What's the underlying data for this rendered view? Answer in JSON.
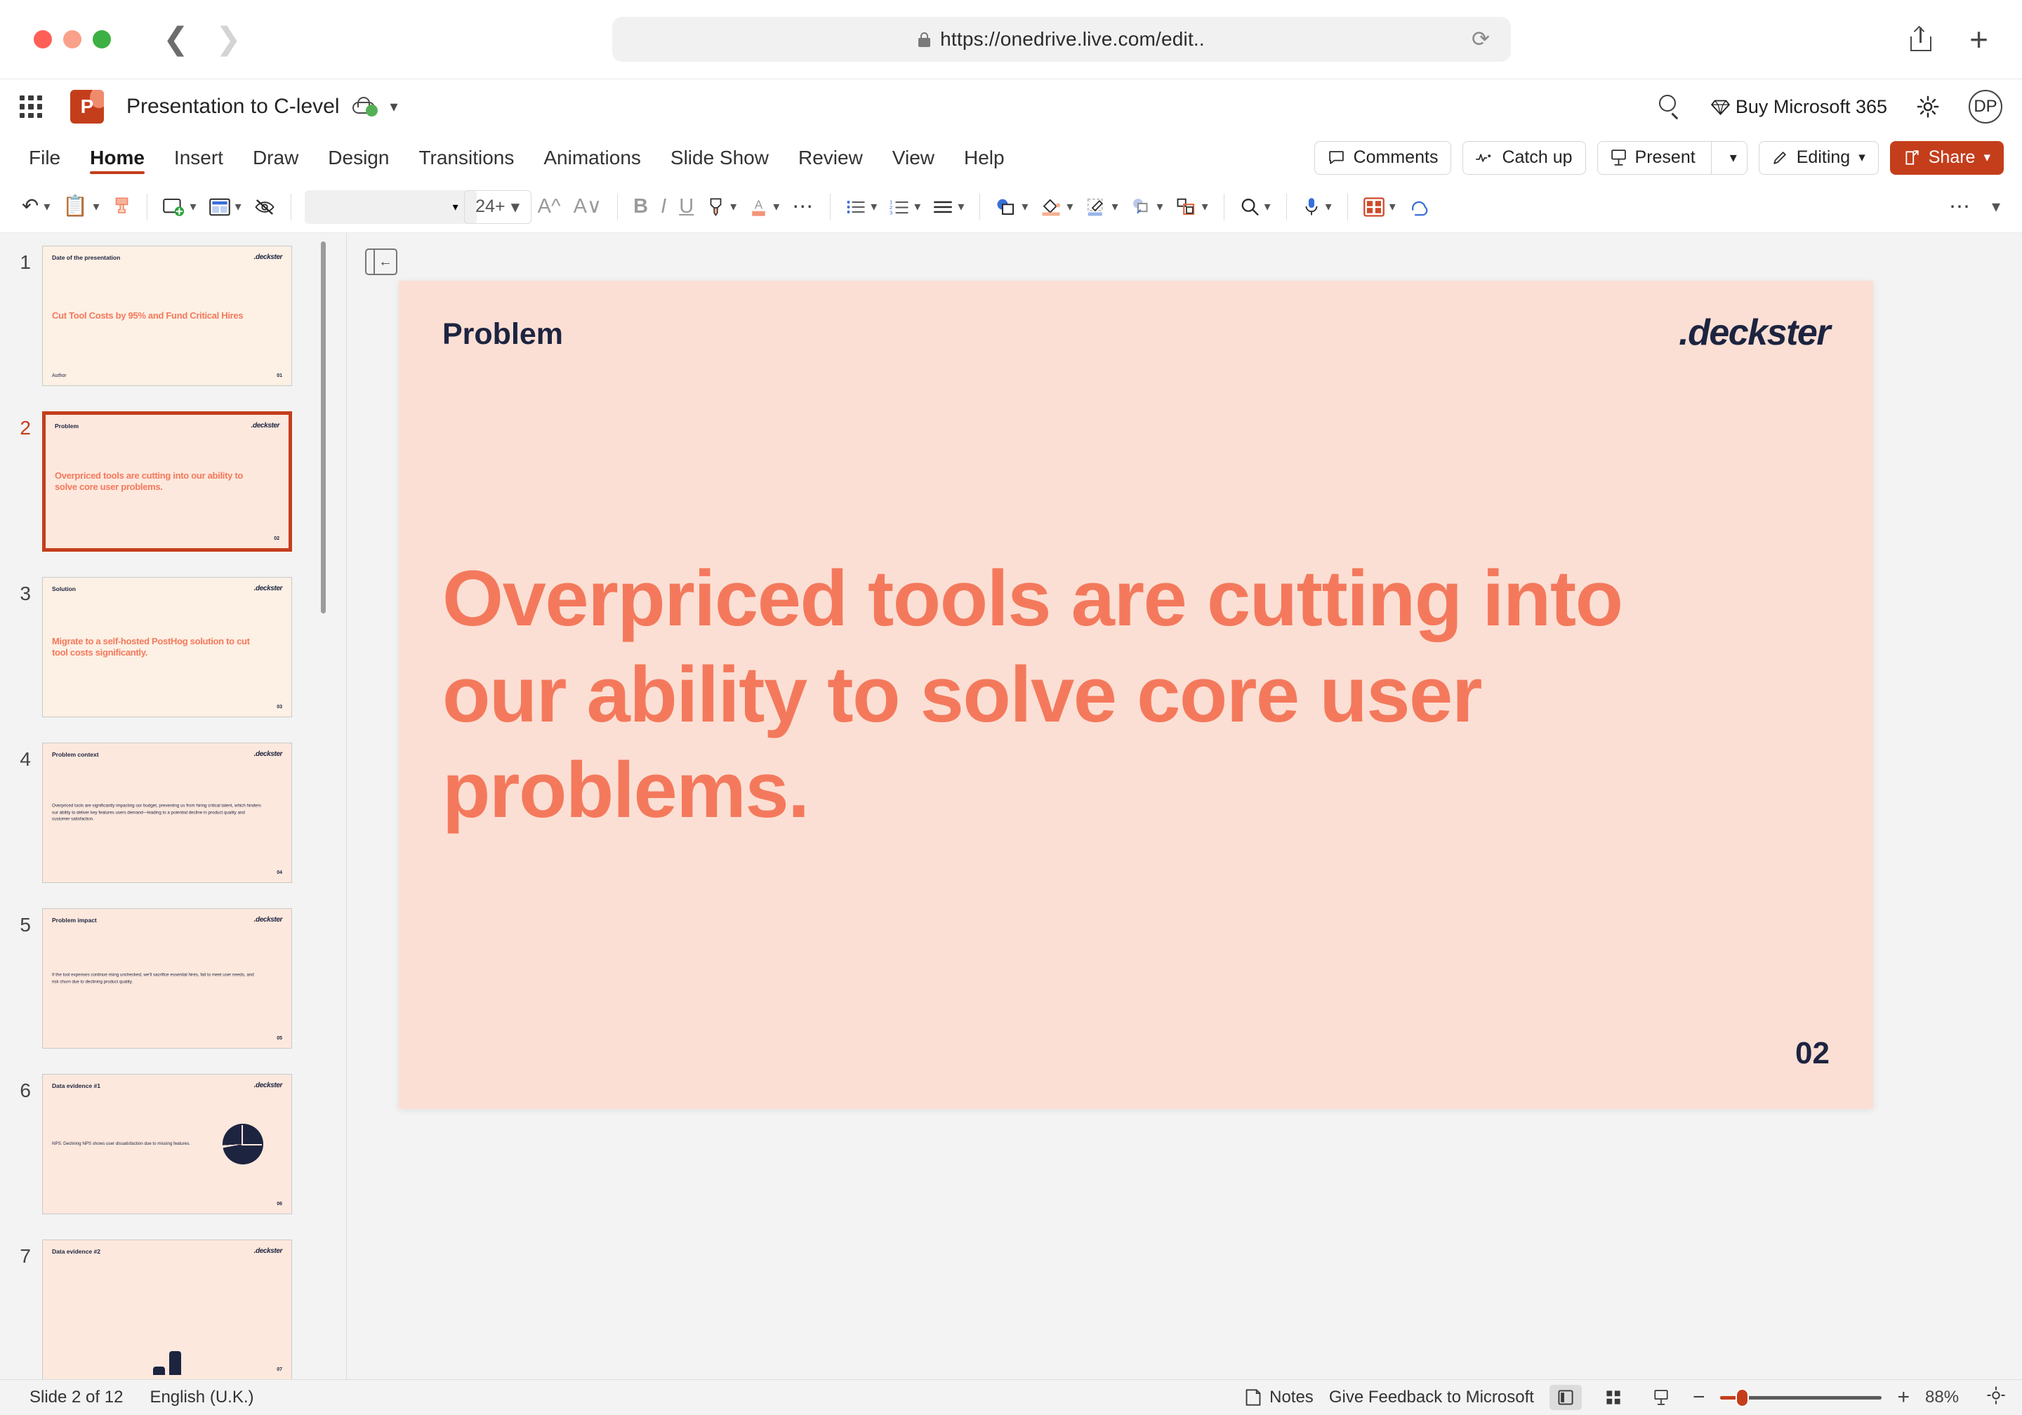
{
  "browser": {
    "url": "https://onedrive.live.com/edit..",
    "back_label": "Back",
    "forward_label": "Forward",
    "reload_label": "Reload",
    "share_label": "Share",
    "new_tab_label": "New Tab"
  },
  "header": {
    "app_launcher": "App launcher",
    "app_name": "P",
    "doc_title": "Presentation to C-level",
    "search_label": "Search",
    "buy_365": "Buy Microsoft 365",
    "settings_label": "Settings",
    "avatar_initials": "DP"
  },
  "ribbon": {
    "tabs": [
      {
        "label": "File",
        "active": false
      },
      {
        "label": "Home",
        "active": true
      },
      {
        "label": "Insert",
        "active": false
      },
      {
        "label": "Draw",
        "active": false
      },
      {
        "label": "Design",
        "active": false
      },
      {
        "label": "Transitions",
        "active": false
      },
      {
        "label": "Animations",
        "active": false
      },
      {
        "label": "Slide Show",
        "active": false
      },
      {
        "label": "Review",
        "active": false
      },
      {
        "label": "View",
        "active": false
      },
      {
        "label": "Help",
        "active": false
      }
    ],
    "comments": "Comments",
    "catch_up": "Catch up",
    "present": "Present",
    "editing": "Editing",
    "share": "Share"
  },
  "toolbar": {
    "undo": "Undo",
    "paste": "Paste",
    "format_painter": "Format Painter",
    "new_slide": "New Slide",
    "layout": "Layout",
    "reset": "Reset",
    "font_name": "",
    "font_name_placeholder": "",
    "font_size": "24+",
    "grow_font": "Increase Font Size",
    "shrink_font": "Decrease Font Size",
    "bold": "B",
    "italic": "I",
    "underline": "U",
    "highlight": "Text Highlight Color",
    "font_color": "Font Color",
    "more_font": "More Font Options",
    "bullets": "Bullets",
    "numbering": "Numbering",
    "align": "Align",
    "shapes": "Shapes",
    "shape_fill": "Shape Fill",
    "shape_outline": "Shape Outline",
    "shape_effects": "Shape Effects",
    "arrange": "Arrange",
    "find": "Find",
    "dictate": "Dictate",
    "designer": "Designer",
    "copilot": "Copilot",
    "more": "More options",
    "collapse_ribbon": "Collapse ribbon"
  },
  "thumbnails": {
    "collapse_panel": "Collapse panel",
    "slides": [
      {
        "num": "1",
        "label": "Date of the presentation",
        "logo": ".deckster",
        "heading": "Cut Tool Costs by 95% and Fund Critical Hires",
        "body": "",
        "footer": "Author",
        "page_num": "01",
        "theme": "cream",
        "selected": false,
        "visual": "none"
      },
      {
        "num": "2",
        "label": "Problem",
        "logo": ".deckster",
        "heading": "Overpriced tools are cutting into our ability to solve core user problems.",
        "body": "",
        "page_num": "02",
        "theme": "peach",
        "selected": true,
        "visual": "none"
      },
      {
        "num": "3",
        "label": "Solution",
        "logo": ".deckster",
        "heading": "Migrate to a self-hosted PostHog solution to cut tool costs significantly.",
        "body": "",
        "page_num": "03",
        "theme": "cream",
        "selected": false,
        "visual": "none"
      },
      {
        "num": "4",
        "label": "Problem context",
        "logo": ".deckster",
        "heading": "",
        "body": "Overpriced tools are significantly impacting our budget, preventing us from hiring critical talent, which hinders our ability to deliver key features users demand—leading to a potential decline in product quality and customer satisfaction.",
        "page_num": "04",
        "theme": "peach",
        "selected": false,
        "visual": "none"
      },
      {
        "num": "5",
        "label": "Problem impact",
        "logo": ".deckster",
        "heading": "",
        "body": "If the tool expenses continue rising unchecked, we'll sacrifice essential hires, fail to meet user needs, and risk churn due to declining product quality.",
        "page_num": "05",
        "theme": "peach",
        "selected": false,
        "visual": "none"
      },
      {
        "num": "6",
        "label": "Data evidence #1",
        "logo": ".deckster",
        "heading": "",
        "body": "NPS: Declining NPS shows user dissatisfaction due to missing features.",
        "page_num": "06",
        "theme": "peach",
        "selected": false,
        "visual": "pie"
      },
      {
        "num": "7",
        "label": "Data evidence #2",
        "logo": ".deckster",
        "heading": "",
        "body": "",
        "page_num": "07",
        "theme": "peach",
        "selected": false,
        "visual": "bars"
      }
    ]
  },
  "slide": {
    "label": "Problem",
    "logo": ".deckster",
    "heading": "Overpriced tools are cutting into our ability to solve core user problems.",
    "page_num": "02"
  },
  "status": {
    "slide_count": "Slide 2 of 12",
    "language": "English (U.K.)",
    "notes": "Notes",
    "feedback": "Give Feedback to Microsoft",
    "normal_view": "Normal view",
    "sorter_view": "Slide sorter view",
    "present_view": "Slide show",
    "zoom_out": "Zoom out",
    "zoom_in": "Zoom in",
    "zoom_level": "88%",
    "fit_slide": "Fit slide to window"
  },
  "colors": {
    "accent_red": "#c43e1c",
    "slide_coral": "#f4795c",
    "slide_bg": "#fbdfd4",
    "slide_cream": "#fdf0e4",
    "navy": "#1d2440"
  }
}
